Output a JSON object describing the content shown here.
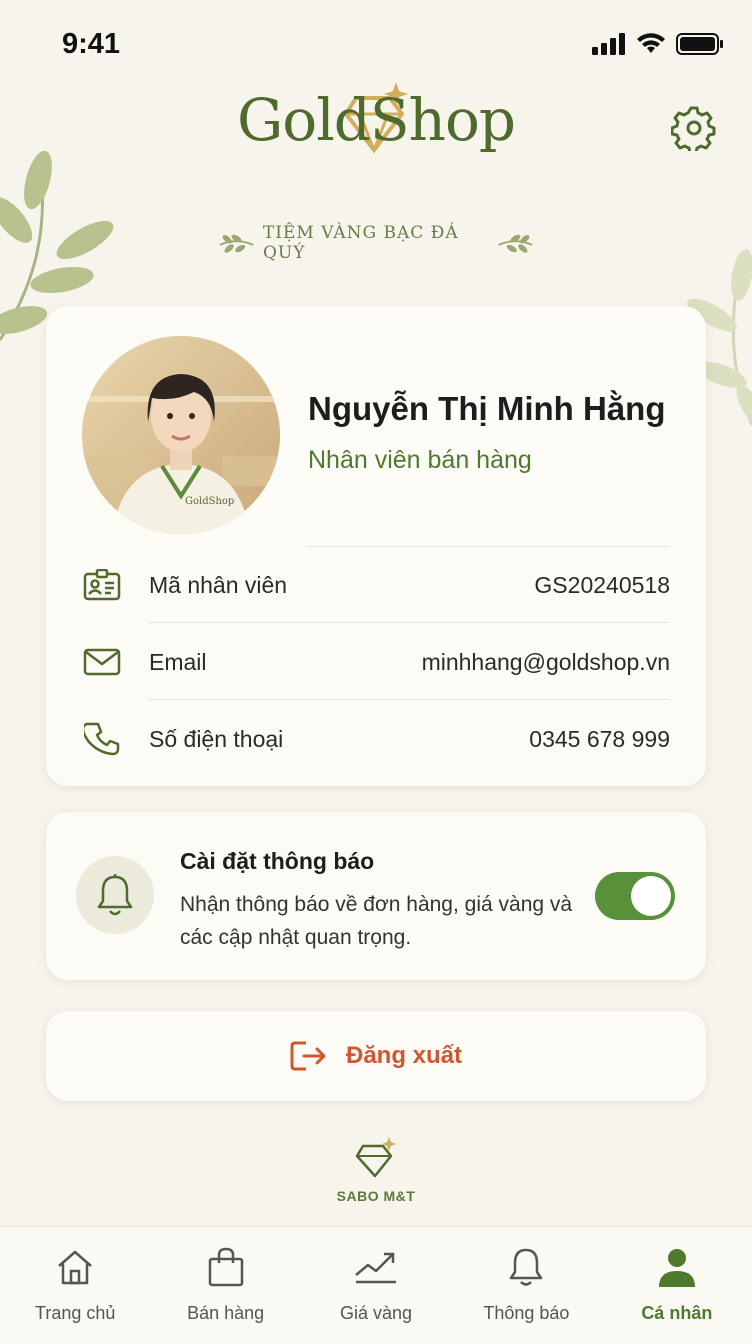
{
  "status_bar": {
    "time": "9:41"
  },
  "brand": {
    "name": "GoldShop",
    "tagline": "TIỆM VÀNG BẠC ĐÁ QUÝ"
  },
  "profile": {
    "name": "Nguyễn Thị Minh Hằng",
    "role": "Nhân viên bán hàng",
    "avatar_badge": "GoldShop",
    "rows": [
      {
        "icon": "id-card-icon",
        "label": "Mã nhân viên",
        "value": "GS20240518"
      },
      {
        "icon": "mail-icon",
        "label": "Email",
        "value": "minhhang@goldshop.vn"
      },
      {
        "icon": "phone-icon",
        "label": "Số điện thoại",
        "value": "0345 678 999"
      }
    ]
  },
  "notifications": {
    "title": "Cài đặt thông báo",
    "description": "Nhận thông báo về đơn hàng, giá vàng và các cập nhật quan trọng.",
    "enabled": true
  },
  "logout": {
    "label": "Đăng xuất"
  },
  "footer": {
    "text": "SABO M&T"
  },
  "tabbar": {
    "active": "Cá nhân",
    "items": [
      {
        "label": "Trang chủ",
        "icon": "home-icon"
      },
      {
        "label": "Bán hàng",
        "icon": "shopping-bag-icon"
      },
      {
        "label": "Giá vàng",
        "icon": "trend-chart-icon"
      },
      {
        "label": "Thông báo",
        "icon": "bell-icon"
      },
      {
        "label": "Cá nhân",
        "icon": "user-icon"
      }
    ]
  },
  "colors": {
    "accent_green": "#4e7a2e",
    "gold": "#d2ad5c",
    "logout_red": "#d2562e",
    "background": "#f7f4ec"
  }
}
